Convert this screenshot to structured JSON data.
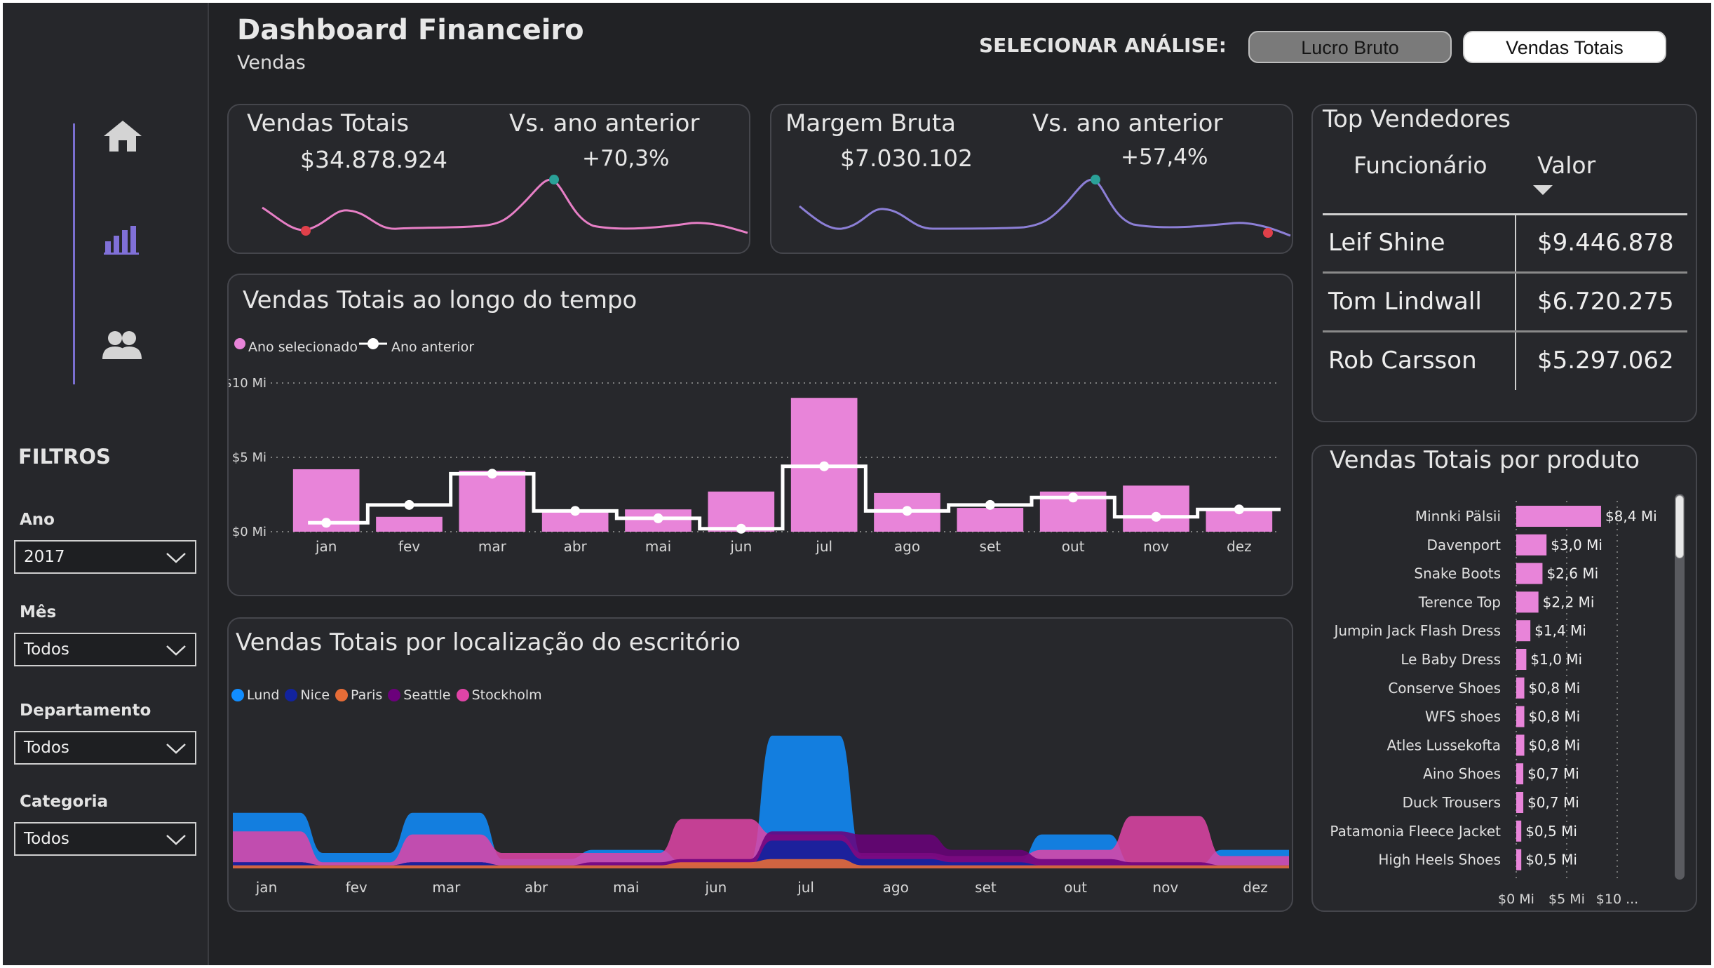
{
  "header": {
    "title": "Dashboard Financeiro",
    "subtitle": "Vendas",
    "select_label": "SELECIONAR ANÁLISE:",
    "options": [
      "Lucro Bruto",
      "Vendas Totais"
    ],
    "selected": "Vendas Totais"
  },
  "nav": {
    "items": [
      "home-icon",
      "bar-chart-icon",
      "users-icon"
    ]
  },
  "filters": {
    "title": "FILTROS",
    "fields": [
      {
        "label": "Ano",
        "value": "2017"
      },
      {
        "label": "Mês",
        "value": "Todos"
      },
      {
        "label": "Departamento",
        "value": "Todos"
      },
      {
        "label": "Categoria",
        "value": "Todos"
      }
    ]
  },
  "kpi_sales": {
    "label": "Vendas Totais",
    "value": "$34.878.924",
    "vs_label": "Vs. ano anterior",
    "vs_value": "+70,3%"
  },
  "kpi_margin": {
    "label": "Margem Bruta",
    "value": "$7.030.102",
    "vs_label": "Vs. ano anterior",
    "vs_value": "+57,4%"
  },
  "top_sellers": {
    "title": "Top Vendedores",
    "columns": [
      "Funcionário",
      "Valor"
    ],
    "rows": [
      {
        "name": "Leif Shine",
        "value": "$9.446.878"
      },
      {
        "name": "Tom Lindwall",
        "value": "$6.720.275"
      },
      {
        "name": "Rob Carsson",
        "value": "$5.297.062"
      }
    ]
  },
  "colors": {
    "pink": "#e884d9",
    "purple_line": "#8c7fd6",
    "teal_dot": "#2aa198",
    "red_dot": "#e0404a",
    "lund": "#118dff",
    "nice": "#12239e",
    "paris": "#e66c37",
    "seattle": "#6b007b",
    "stockholm": "#e044a7"
  },
  "chart_data": [
    {
      "id": "time",
      "type": "bar",
      "title": "Vendas Totais ao longo do tempo",
      "categories": [
        "jan",
        "fev",
        "mar",
        "abr",
        "mai",
        "jun",
        "jul",
        "ago",
        "set",
        "out",
        "nov",
        "dez"
      ],
      "series": [
        {
          "name": "Ano selecionado",
          "values": [
            4.2,
            1.0,
            4.1,
            1.3,
            1.5,
            2.7,
            9.0,
            2.6,
            1.6,
            2.7,
            3.1,
            1.5
          ]
        },
        {
          "name": "Ano anterior",
          "values": [
            0.6,
            1.8,
            3.9,
            1.4,
            0.9,
            0.2,
            4.4,
            1.4,
            1.8,
            2.3,
            1.0,
            1.5
          ]
        }
      ],
      "yticks": [
        "$0 Mi",
        "$5 Mi",
        "$10 Mi"
      ],
      "ylim": [
        0,
        10
      ]
    },
    {
      "id": "location",
      "type": "area",
      "title": "Vendas Totais por localização do escritório",
      "categories": [
        "jan",
        "fev",
        "mar",
        "abr",
        "mai",
        "jun",
        "jul",
        "ago",
        "set",
        "out",
        "nov",
        "dez"
      ],
      "series": [
        {
          "name": "Lund",
          "values": [
            1.8,
            0.5,
            1.8,
            0.3,
            0.6,
            0.2,
            4.3,
            0.4,
            0.2,
            1.1,
            0.1,
            0.6
          ]
        },
        {
          "name": "Nice",
          "values": [
            0.2,
            0.1,
            0.2,
            0.1,
            0.1,
            0.1,
            0.9,
            0.3,
            0.2,
            0.1,
            0.1,
            0.1
          ]
        },
        {
          "name": "Paris",
          "values": [
            0.1,
            0.1,
            0.1,
            0.1,
            0.1,
            0.2,
            0.3,
            0.1,
            0.1,
            0.1,
            0.1,
            0.1
          ]
        },
        {
          "name": "Seattle",
          "values": [
            0.2,
            0.1,
            0.2,
            0.1,
            0.2,
            0.3,
            1.2,
            1.1,
            0.6,
            0.3,
            0.2,
            0.1
          ]
        },
        {
          "name": "Stockholm",
          "values": [
            1.2,
            0.2,
            1.1,
            0.5,
            0.5,
            1.6,
            1.1,
            0.5,
            0.4,
            0.6,
            1.7,
            0.4
          ]
        }
      ]
    },
    {
      "id": "product",
      "type": "bar",
      "title": "Vendas Totais por produto",
      "categories": [
        "Minnki Pälsii",
        "Davenport",
        "Snake Boots",
        "Terence Top",
        "Jumpin Jack Flash Dress",
        "Le Baby Dress",
        "Conserve Shoes",
        "WFS shoes",
        "Atles Lussekofta",
        "Aino Shoes",
        "Duck Trousers",
        "Patamonia Fleece Jacket",
        "High Heels Shoes"
      ],
      "values": [
        8.4,
        3.0,
        2.6,
        2.2,
        1.4,
        1.0,
        0.8,
        0.8,
        0.8,
        0.7,
        0.7,
        0.5,
        0.5
      ],
      "labels": [
        "$8,4 Mi",
        "$3,0 Mi",
        "$2,6 Mi",
        "$2,2 Mi",
        "$1,4 Mi",
        "$1,0 Mi",
        "$0,8 Mi",
        "$0,8 Mi",
        "$0,8 Mi",
        "$0,7 Mi",
        "$0,7 Mi",
        "$0,5 Mi",
        "$0,5 Mi"
      ],
      "xticks": [
        "$0 Mi",
        "$5 Mi",
        "$10 ..."
      ],
      "xlim": [
        0,
        10
      ]
    }
  ]
}
